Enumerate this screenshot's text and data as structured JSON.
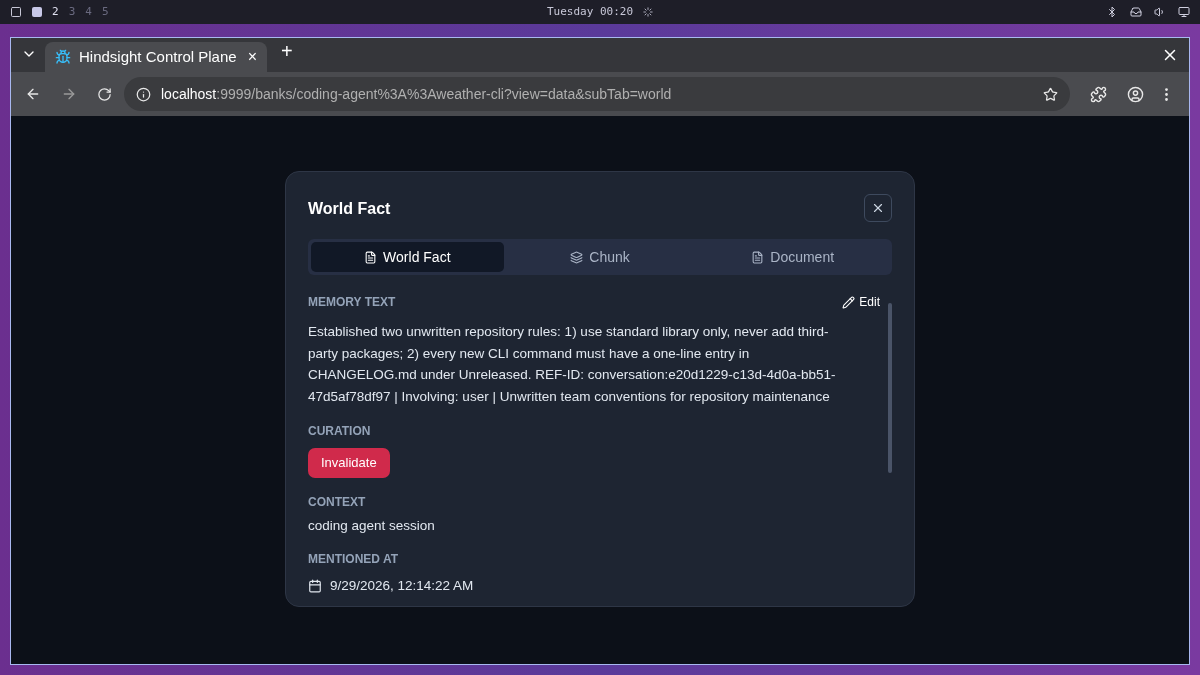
{
  "desktop_bar": {
    "workspaces": [
      {
        "label": "2",
        "occupied": true
      },
      {
        "label": "3",
        "occupied": false
      },
      {
        "label": "4",
        "occupied": false
      },
      {
        "label": "5",
        "occupied": false
      }
    ],
    "clock": "Tuesday 00:20"
  },
  "browser": {
    "tab": {
      "title": "Hindsight Control Plane",
      "close": "×"
    },
    "new_tab": "+",
    "url_host": "localhost",
    "url_path": ":9999/banks/coding-agent%3A%3Aweather-cli?view=data&subTab=world"
  },
  "modal": {
    "title": "World Fact",
    "tabs": [
      {
        "label": "World Fact",
        "kind": "file",
        "selected": true
      },
      {
        "label": "Chunk",
        "kind": "layers",
        "selected": false
      },
      {
        "label": "Document",
        "kind": "file",
        "selected": false
      }
    ],
    "memory_text": {
      "heading": "MEMORY TEXT",
      "edit": "Edit",
      "body": "Established two unwritten repository rules: 1) use standard library only, never add third-party packages; 2) every new CLI command must have a one-line entry in CHANGELOG.md under Unreleased. REF-ID: conversation:e20d1229-c13d-4d0a-bb51-47d5af78df97 | Involving: user | Unwritten team conventions for repository maintenance"
    },
    "curation": {
      "heading": "CURATION",
      "button": "Invalidate"
    },
    "context": {
      "heading": "CONTEXT",
      "value": "coding agent session"
    },
    "mentioned_at": {
      "heading": "MENTIONED AT",
      "value": "9/29/2026, 12:14:22 AM"
    }
  }
}
